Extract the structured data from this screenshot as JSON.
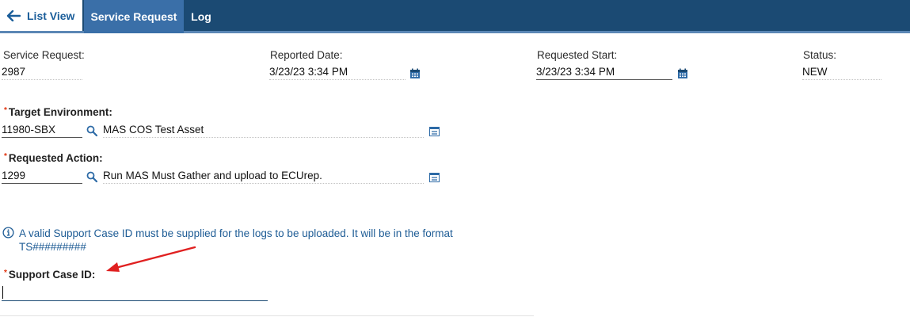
{
  "tabs": {
    "list_view": "List View",
    "service_request": "Service Request",
    "log": "Log"
  },
  "fields": {
    "service_request": {
      "label": "Service Request:",
      "value": "2987"
    },
    "reported_date": {
      "label": "Reported Date:",
      "value": "3/23/23 3:34 PM"
    },
    "requested_start": {
      "label": "Requested Start:",
      "value": "3/23/23 3:34 PM"
    },
    "status": {
      "label": "Status:",
      "value": "NEW"
    },
    "target_environment": {
      "label": "Target Environment:",
      "value": "11980-SBX",
      "description": "MAS COS Test Asset"
    },
    "requested_action": {
      "label": "Requested Action:",
      "value": "1299",
      "description": "Run MAS Must Gather and upload to ECUrep."
    },
    "support_case_id": {
      "label": "Support Case ID:",
      "value": ""
    }
  },
  "info_message": "A valid Support Case ID must be supplied for the logs to be uploaded. It will be in the format TS#########",
  "colors": {
    "header": "#1b4a73",
    "active_tab": "#3a6fa8",
    "link": "#1b5e9a",
    "required_star": "#e1330e",
    "annotation_arrow": "#e02020"
  }
}
